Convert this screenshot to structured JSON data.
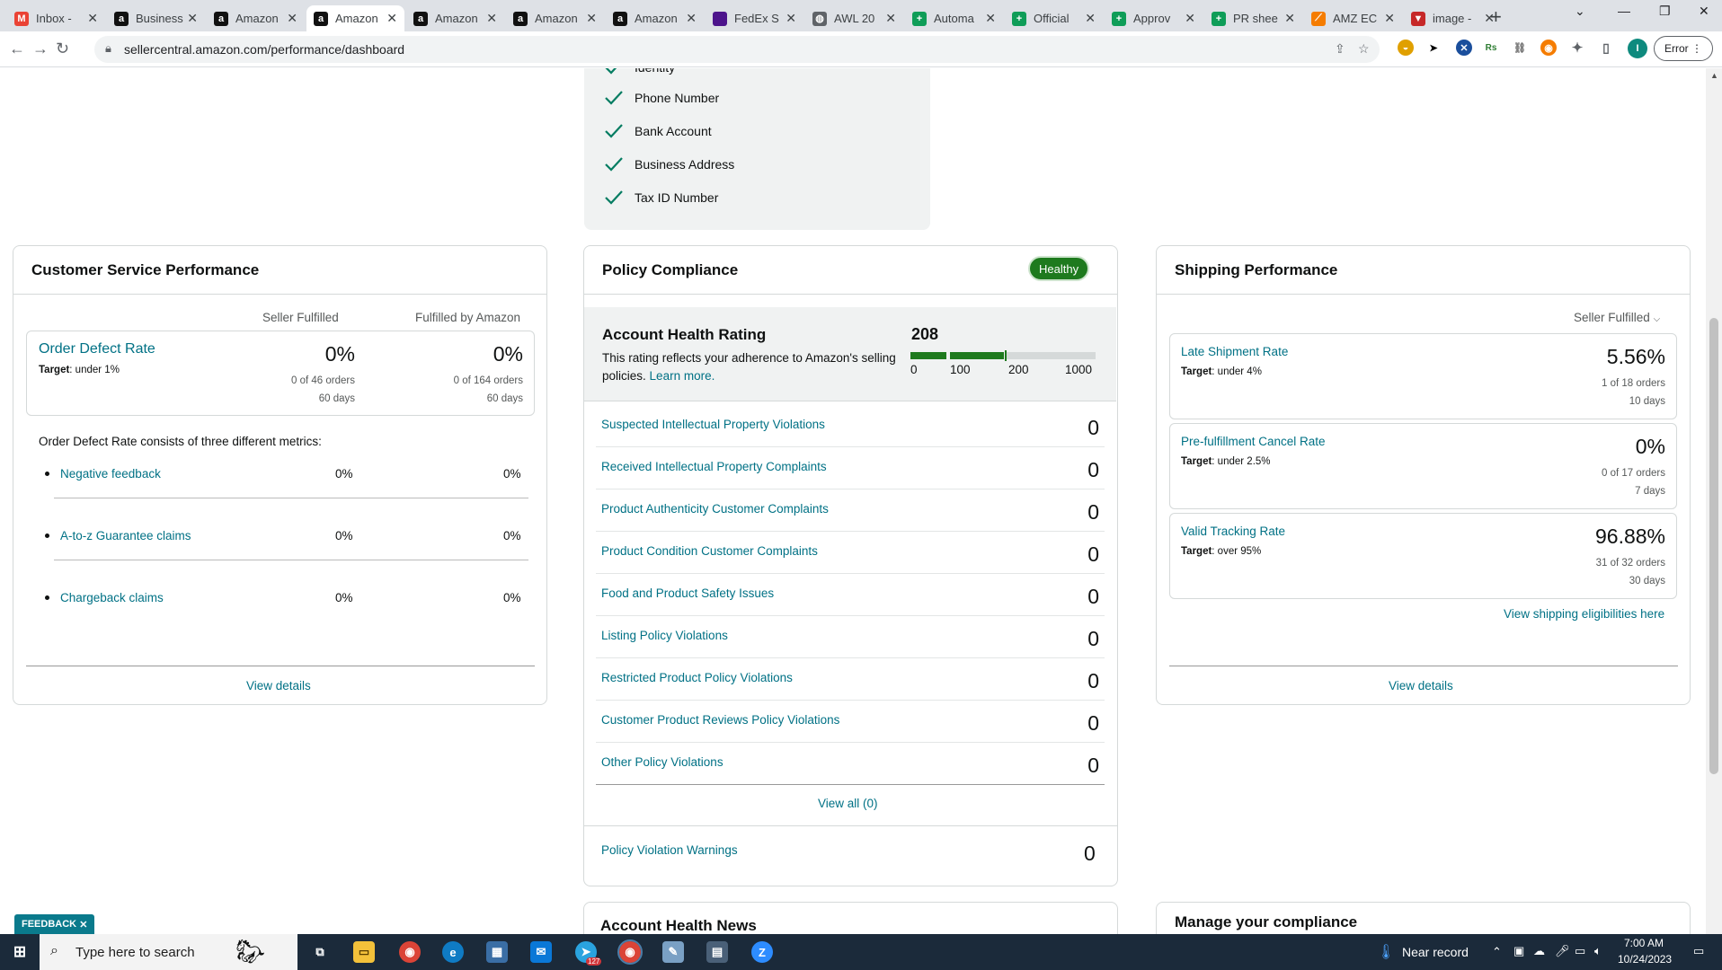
{
  "browser": {
    "tabs": [
      {
        "title": "Inbox -",
        "icon": "gmail-icon",
        "color": "#ea4335",
        "glyph": "M"
      },
      {
        "title": "Business",
        "icon": "amazon-icon",
        "color": "#111111",
        "glyph": "a"
      },
      {
        "title": "Amazon",
        "icon": "amazon-icon",
        "color": "#111111",
        "glyph": "a"
      },
      {
        "title": "Amazon",
        "icon": "amazon-icon",
        "color": "#111111",
        "glyph": "a",
        "active": true
      },
      {
        "title": "Amazon",
        "icon": "amazon-icon",
        "color": "#111111",
        "glyph": "a"
      },
      {
        "title": "Amazon",
        "icon": "amazon-icon",
        "color": "#111111",
        "glyph": "a"
      },
      {
        "title": "Amazon",
        "icon": "amazon-icon",
        "color": "#111111",
        "glyph": "a"
      },
      {
        "title": "FedEx S",
        "icon": "fedex-icon",
        "color": "#4d148c",
        "glyph": ""
      },
      {
        "title": "AWL 20",
        "icon": "globe-icon",
        "color": "#5f6368",
        "glyph": "◍"
      },
      {
        "title": "Automa",
        "icon": "sheets-icon",
        "color": "#0f9d58",
        "glyph": "+"
      },
      {
        "title": "Official",
        "icon": "sheets-icon",
        "color": "#0f9d58",
        "glyph": "+"
      },
      {
        "title": "Approv",
        "icon": "sheets-icon",
        "color": "#0f9d58",
        "glyph": "+"
      },
      {
        "title": "PR shee",
        "icon": "sheets-icon",
        "color": "#0f9d58",
        "glyph": "+"
      },
      {
        "title": "AMZ EC",
        "icon": "amz-ec-icon",
        "color": "#f57c00",
        "glyph": "⟋"
      },
      {
        "title": "image -",
        "icon": "image-icon",
        "color": "#c62828",
        "glyph": "▼"
      }
    ],
    "url": "sellercentral.amazon.com/performance/dashboard",
    "error_label": "Error",
    "profile_initial": "I"
  },
  "verification": {
    "items": [
      "Identity",
      "Phone Number",
      "Bank Account",
      "Business Address",
      "Tax ID Number"
    ]
  },
  "customer_service": {
    "title": "Customer Service Performance",
    "col_seller": "Seller Fulfilled",
    "col_fba": "Fulfilled by Amazon",
    "odr_label": "Order Defect Rate",
    "odr_target_prefix": "Target",
    "odr_target": ": under 1%",
    "seller_rate": "0%",
    "seller_orders": "0 of 46 orders",
    "seller_days": "60 days",
    "fba_rate": "0%",
    "fba_orders": "0 of 164 orders",
    "fba_days": "60 days",
    "consists_text": "Order Defect Rate consists of three different metrics:",
    "metrics": [
      {
        "label": "Negative feedback",
        "seller": "0%",
        "fba": "0%"
      },
      {
        "label": "A-to-z Guarantee claims",
        "seller": "0%",
        "fba": "0%"
      },
      {
        "label": "Chargeback claims",
        "seller": "0%",
        "fba": "0%"
      }
    ],
    "view_details": "View details"
  },
  "policy": {
    "title": "Policy Compliance",
    "status": "Healthy",
    "ahr_title": "Account Health Rating",
    "ahr_desc": "This rating reflects your adherence to Amazon's selling policies.",
    "learn_more": "Learn more.",
    "ahr_score": "208",
    "scale_labels": [
      "0",
      "100",
      "200",
      "1000"
    ],
    "rows": [
      {
        "label": "Suspected Intellectual Property Violations",
        "value": "0"
      },
      {
        "label": "Received Intellectual Property Complaints",
        "value": "0"
      },
      {
        "label": "Product Authenticity Customer Complaints",
        "value": "0"
      },
      {
        "label": "Product Condition Customer Complaints",
        "value": "0"
      },
      {
        "label": "Food and Product Safety Issues",
        "value": "0"
      },
      {
        "label": "Listing Policy Violations",
        "value": "0"
      },
      {
        "label": "Restricted Product Policy Violations",
        "value": "0"
      },
      {
        "label": "Customer Product Reviews Policy Violations",
        "value": "0"
      },
      {
        "label": "Other Policy Violations",
        "value": "0"
      }
    ],
    "view_all": "View all (0)",
    "warnings_label": "Policy Violation Warnings",
    "warnings_value": "0"
  },
  "shipping": {
    "title": "Shipping Performance",
    "filter": "Seller Fulfilled",
    "rows": [
      {
        "label": "Late Shipment Rate",
        "target": ": under 4%",
        "rate": "5.56%",
        "orders": "1 of 18 orders",
        "days": "10 days"
      },
      {
        "label": "Pre-fulfillment Cancel Rate",
        "target": ": under 2.5%",
        "rate": "0%",
        "orders": "0 of 17 orders",
        "days": "7 days"
      },
      {
        "label": "Valid Tracking Rate",
        "target": ": over 95%",
        "rate": "96.88%",
        "orders": "31 of 32 orders",
        "days": "30 days"
      }
    ],
    "target_prefix": "Target",
    "eligibilities": "View shipping eligibilities here",
    "view_details": "View details"
  },
  "lower": {
    "news_title": "Account Health News",
    "compliance_title": "Manage your compliance"
  },
  "feedback_label": "FEEDBACK",
  "taskbar": {
    "search_placeholder": "Type here to search",
    "weather": "Near record",
    "time": "7:00 AM",
    "date": "10/24/2023",
    "telegram_badge": "127"
  },
  "colors": {
    "link": "#007185",
    "healthy": "#1e7a1e",
    "check": "#067d62"
  }
}
